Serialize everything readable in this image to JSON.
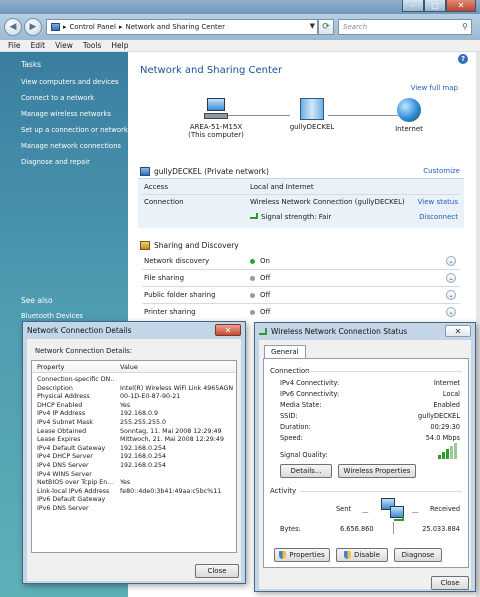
{
  "explorer": {
    "breadcrumb": [
      "Control Panel",
      "Network and Sharing Center"
    ],
    "search_placeholder": "Search",
    "menu": [
      "File",
      "Edit",
      "View",
      "Tools",
      "Help"
    ],
    "sidebar": {
      "title": "Tasks",
      "links": [
        "View computers and devices",
        "Connect to a network",
        "Manage wireless networks",
        "Set up a connection or network",
        "Manage network connections",
        "Diagnose and repair"
      ],
      "see_also": "See also",
      "see_also_link": "Bluetooth Devices"
    },
    "page_title": "Network and Sharing Center",
    "view_full_map": "View full map",
    "nodes": {
      "computer_name": "AREA-51-M15X",
      "computer_sub": "(This computer)",
      "network": "gullyDECKEL",
      "internet": "Internet"
    },
    "network_header": "gullyDECKEL (Private network)",
    "customize": "Customize",
    "access_label": "Access",
    "access_value": "Local and Internet",
    "connection_label": "Connection",
    "connection_value": "Wireless Network Connection (gullyDECKEL)",
    "view_status": "View status",
    "signal_strength": "Signal strength: Fair",
    "disconnect": "Disconnect",
    "sharing_header": "Sharing and Discovery",
    "sharing": [
      {
        "label": "Network discovery",
        "value": "On",
        "color": "#2fa52f"
      },
      {
        "label": "File sharing",
        "value": "Off",
        "color": "#9a9a9a"
      },
      {
        "label": "Public folder sharing",
        "value": "Off",
        "color": "#9a9a9a"
      },
      {
        "label": "Printer sharing",
        "value": "Off",
        "color": "#9a9a9a"
      }
    ]
  },
  "details_dialog": {
    "title": "Network Connection Details",
    "subtitle": "Network Connection Details:",
    "col_property": "Property",
    "col_value": "Value",
    "rows": [
      {
        "p": "Connection-specific DN...",
        "v": ""
      },
      {
        "p": "Description",
        "v": "Intel(R) Wireless WiFi Link 4965AGN"
      },
      {
        "p": "Physical Address",
        "v": "00-1D-E0-87-90-21"
      },
      {
        "p": "DHCP Enabled",
        "v": "Yes"
      },
      {
        "p": "IPv4 IP Address",
        "v": "192.168.0.9"
      },
      {
        "p": "IPv4 Subnet Mask",
        "v": "255.255.255.0"
      },
      {
        "p": "Lease Obtained",
        "v": "Sonntag, 11. Mai 2008 12:29:49"
      },
      {
        "p": "Lease Expires",
        "v": "Mittwoch, 21. Mai 2008 12:29:49"
      },
      {
        "p": "IPv4 Default Gateway",
        "v": "192.168.0.254"
      },
      {
        "p": "IPv4 DHCP Server",
        "v": "192.168.0.254"
      },
      {
        "p": "IPv4 DNS Server",
        "v": "192.168.0.254"
      },
      {
        "p": "IPv4 WINS Server",
        "v": ""
      },
      {
        "p": "NetBIOS over Tcpip En...",
        "v": "Yes"
      },
      {
        "p": "Link-local IPv6 Address",
        "v": "fe80::4de0:3b41:49aa:c5bc%11"
      },
      {
        "p": "IPv6 Default Gateway",
        "v": ""
      },
      {
        "p": "IPv6 DNS Server",
        "v": ""
      }
    ],
    "close": "Close"
  },
  "status_dialog": {
    "title": "Wireless Network Connection Status",
    "tab": "General",
    "connection_group": "Connection",
    "fields": [
      {
        "k": "IPv4 Connectivity:",
        "v": "Internet"
      },
      {
        "k": "IPv6 Connectivity:",
        "v": "Local"
      },
      {
        "k": "Media State:",
        "v": "Enabled"
      },
      {
        "k": "SSID:",
        "v": "gullyDECKEL"
      },
      {
        "k": "Duration:",
        "v": "00:29:30"
      },
      {
        "k": "Speed:",
        "v": "54.0 Mbps"
      }
    ],
    "signal_quality": "Signal Quality:",
    "details_btn": "Details...",
    "wireless_props_btn": "Wireless Properties",
    "activity_group": "Activity",
    "sent": "Sent",
    "received": "Received",
    "bytes_label": "Bytes:",
    "bytes_sent": "6.656.860",
    "bytes_received": "25.033.884",
    "properties_btn": "Properties",
    "disable_btn": "Disable",
    "diagnose_btn": "Diagnose",
    "close": "Close"
  }
}
